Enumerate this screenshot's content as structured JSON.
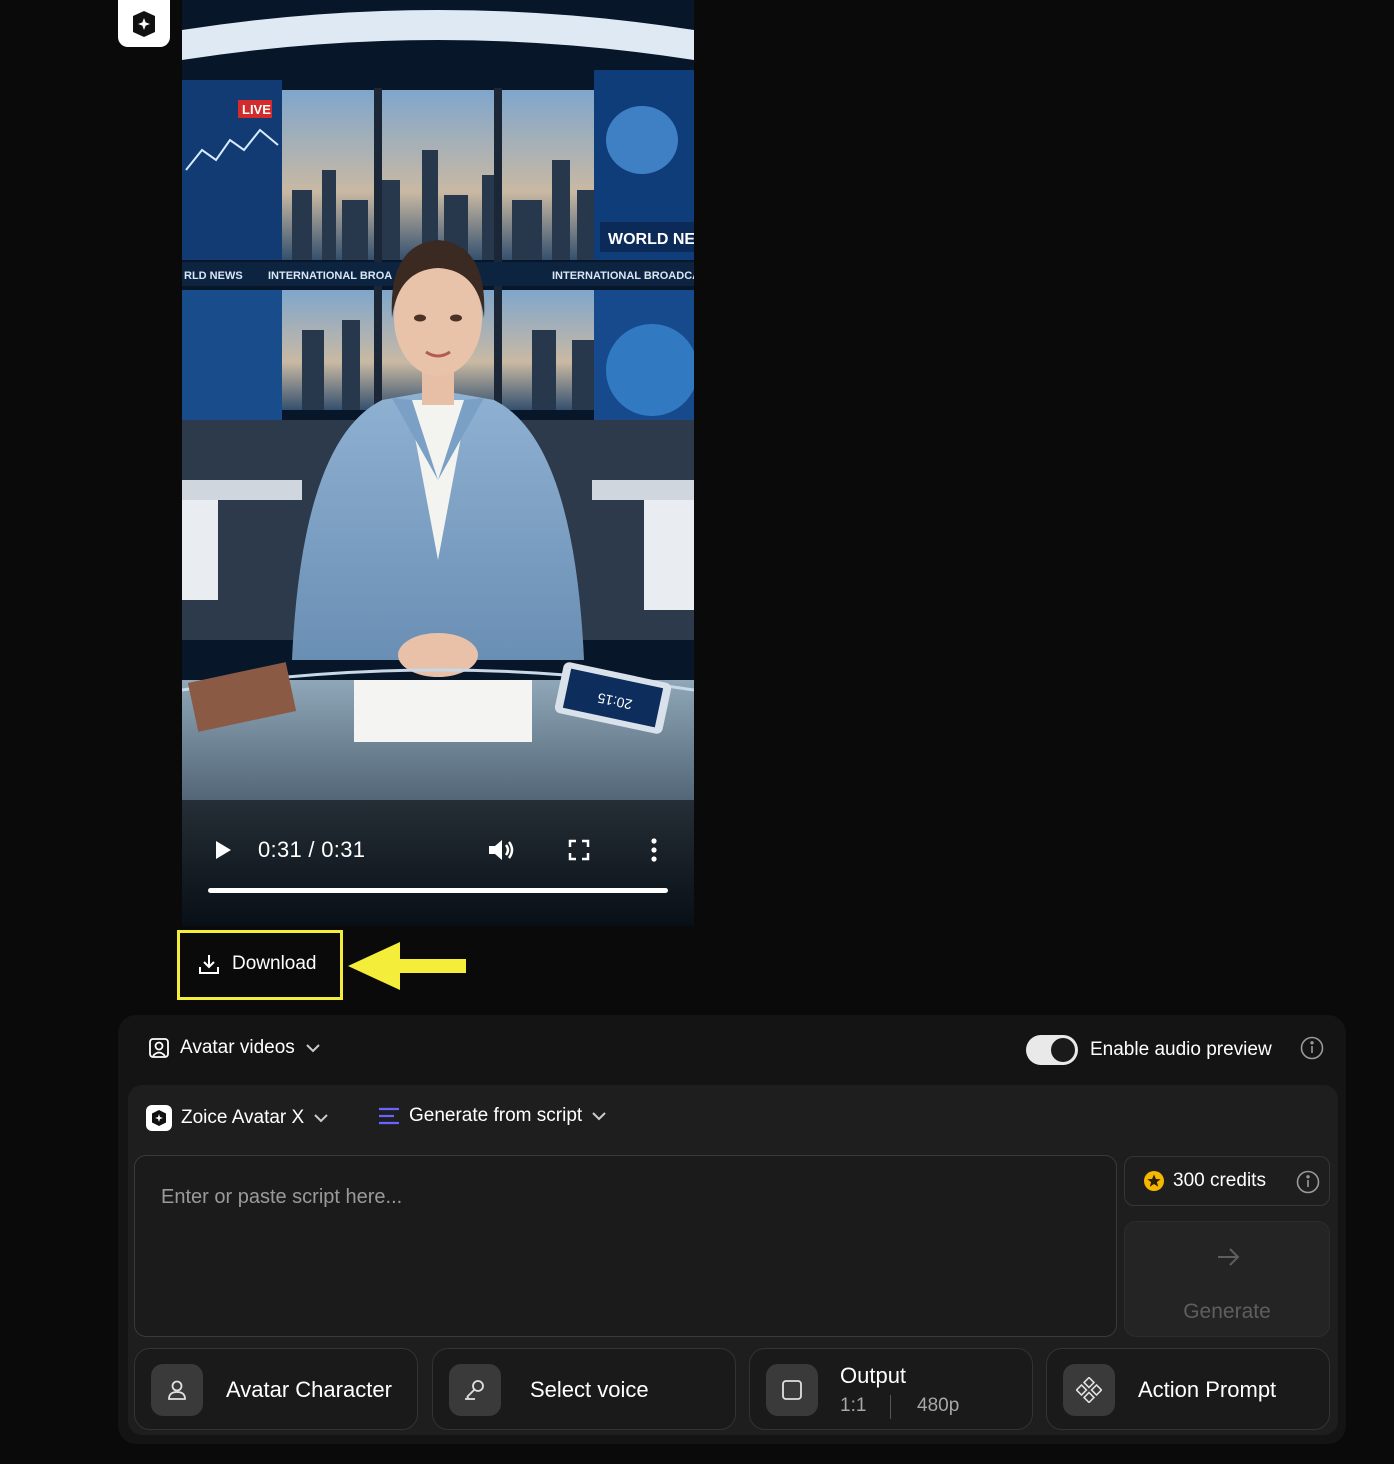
{
  "video": {
    "time": "0:31 / 0:31",
    "progress_fraction": 1.0,
    "scene": {
      "live_badge": "LIVE",
      "screen_banner": "WORLD NEW",
      "ticker_left": "RLD NEWS",
      "ticker_mid": "INTERNATIONAL BROA",
      "ticker_right": "INTERNATIONAL BROADCAST",
      "tablet_time": "20:15"
    },
    "icons": {
      "play": "play-icon",
      "volume": "volume-icon",
      "fullscreen": "fullscreen-icon",
      "more": "more-options-icon"
    }
  },
  "download": {
    "label": "Download",
    "highlight_color": "#f4ee3a"
  },
  "panel": {
    "mode": {
      "label": "Avatar videos"
    },
    "audio_preview": {
      "label": "Enable audio preview",
      "enabled": true
    },
    "model": {
      "label": "Zoice Avatar X"
    },
    "source": {
      "label": "Generate from script"
    },
    "script": {
      "placeholder": "Enter or paste script here...",
      "value": ""
    },
    "credits": {
      "label": "300 credits"
    },
    "generate": {
      "label": "Generate"
    },
    "chips": {
      "avatar": "Avatar Character",
      "voice": "Select voice",
      "output": {
        "label": "Output",
        "ratio": "1:1",
        "resolution": "480p"
      },
      "action": "Action Prompt"
    }
  },
  "colors": {
    "background": "#0a0a0a",
    "panel": "#141414",
    "accent_purple": "#6b63ff",
    "credit_gold": "#f5b700"
  }
}
